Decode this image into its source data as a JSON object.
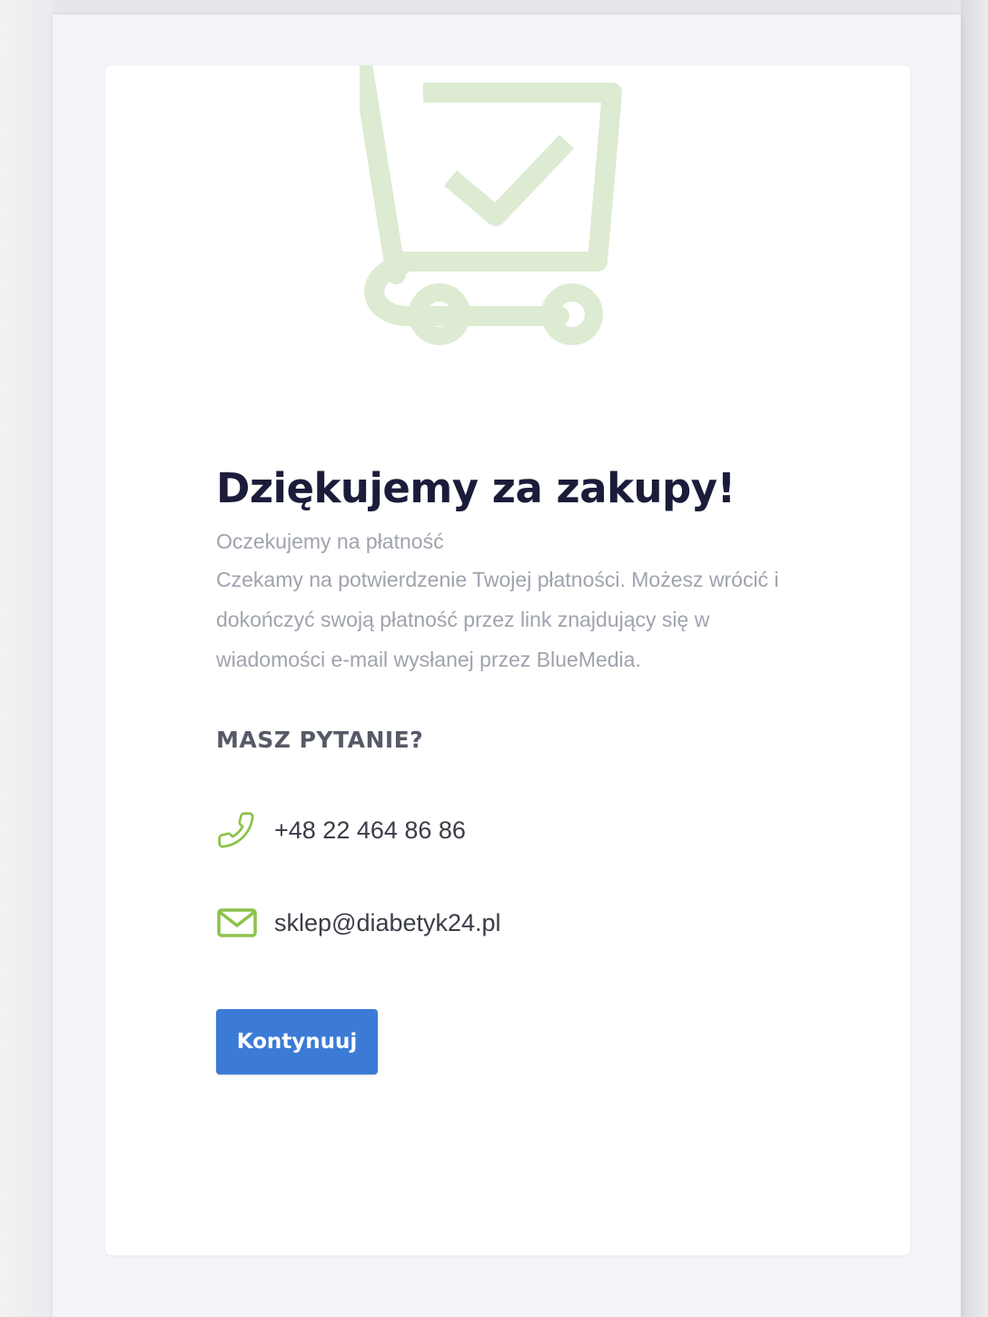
{
  "confirmation": {
    "title": "Dziękujemy za zakupy!",
    "subtitle": "Oczekujemy na płatność",
    "message": "Czekamy na potwierdzenie Twojej płatności. Możesz wrócić i dokończyć swoją płatność przez link znajdujący się w wiadomości e-mail wysłanej przez BlueMedia."
  },
  "contact": {
    "heading": "MASZ PYTANIE?",
    "phone": "+48 22 464 86 86",
    "email": "sklep@diabetyk24.pl"
  },
  "actions": {
    "continue_label": "Kontynuuj"
  },
  "icons": {
    "illustration": "shopping-cart-check-icon",
    "phone": "phone-icon",
    "email": "envelope-icon"
  },
  "colors": {
    "accent_green": "#8bc34a",
    "illustration_green": "#dcebd1",
    "button_blue": "#3b7bd6",
    "title_text": "#1a1c3a",
    "muted_text": "#9fa3ad"
  }
}
